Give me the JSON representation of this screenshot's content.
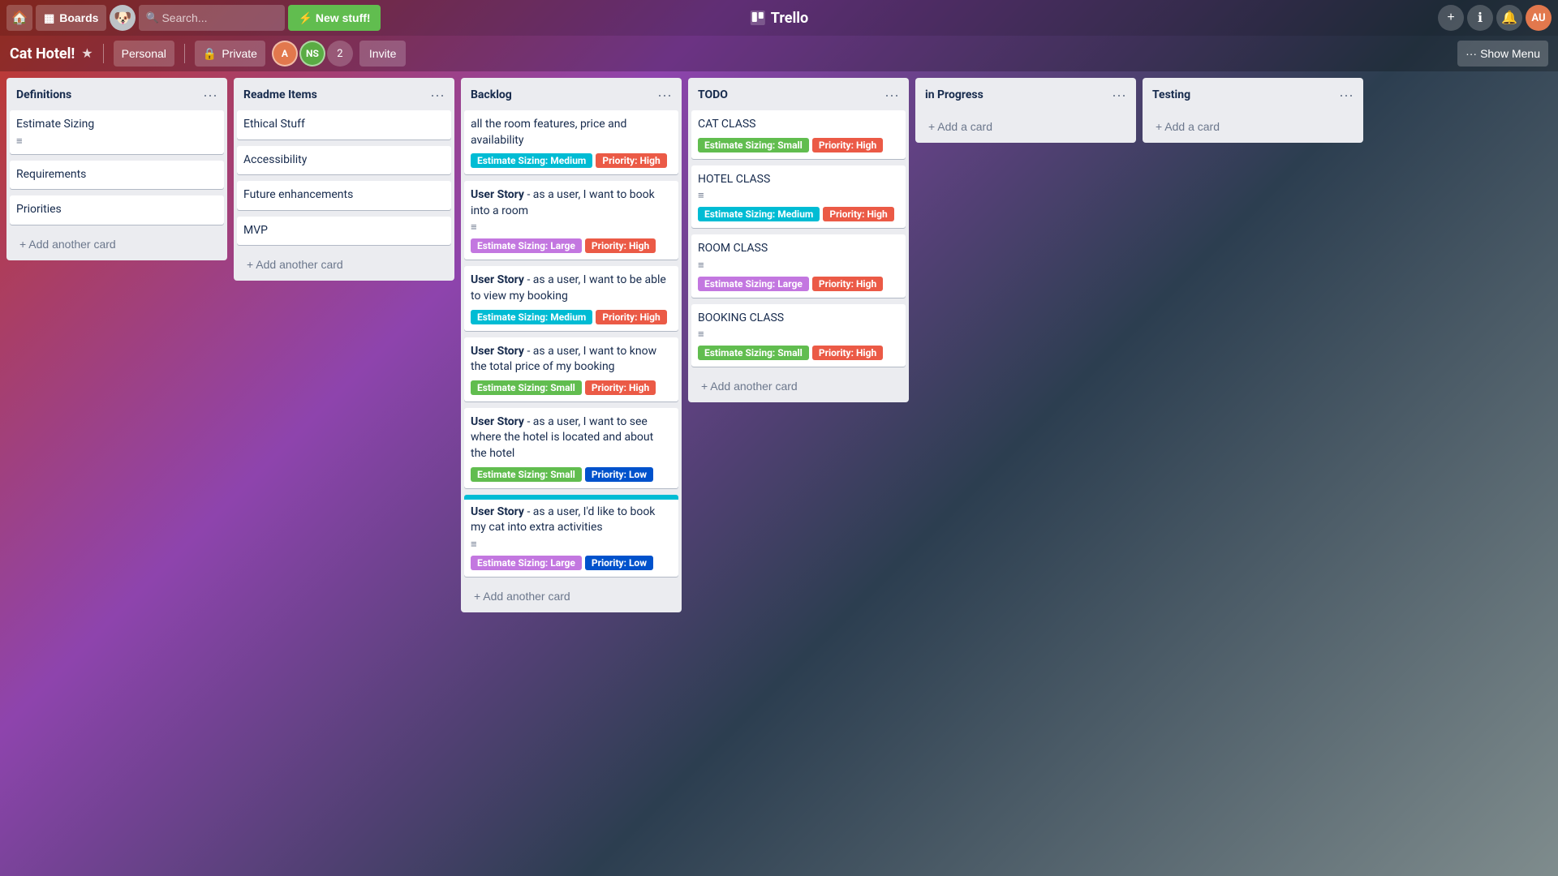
{
  "topNav": {
    "homeLabel": "🏠",
    "boardsLabel": "Boards",
    "searchPlaceholder": "Search...",
    "newStuffLabel": "New stuff!",
    "trelloLogo": "Trello",
    "addIcon": "+",
    "helpIcon": "?",
    "notifIcon": "🔔",
    "plusIcon": "+"
  },
  "boardNav": {
    "title": "Cat Hotel!",
    "starIcon": "★",
    "personalLabel": "Personal",
    "privateIcon": "🔒",
    "privateLabel": "Private",
    "memberCount": "2",
    "inviteLabel": "Invite",
    "showMenuDots": "···",
    "showMenuLabel": "Show Menu"
  },
  "lists": [
    {
      "id": "definitions",
      "title": "Definitions",
      "cards": [
        {
          "id": "d1",
          "title": "Estimate Sizing",
          "badges": [],
          "hasDesc": true,
          "stripe": null
        },
        {
          "id": "d2",
          "title": "Requirements",
          "badges": [],
          "hasDesc": false,
          "stripe": null
        },
        {
          "id": "d3",
          "title": "Priorities",
          "badges": [],
          "hasDesc": false,
          "stripe": null
        }
      ],
      "addLabel": "+ Add another card"
    },
    {
      "id": "readme",
      "title": "Readme Items",
      "cards": [
        {
          "id": "r1",
          "title": "Ethical Stuff",
          "badges": [],
          "hasDesc": false,
          "stripe": null
        },
        {
          "id": "r2",
          "title": "Accessibility",
          "badges": [],
          "hasDesc": false,
          "stripe": null
        },
        {
          "id": "r3",
          "title": "Future enhancements",
          "badges": [],
          "hasDesc": false,
          "stripe": null
        },
        {
          "id": "r4",
          "title": "MVP",
          "badges": [],
          "hasDesc": false,
          "stripe": null
        }
      ],
      "addLabel": "+ Add another card"
    },
    {
      "id": "backlog",
      "title": "Backlog",
      "cards": [
        {
          "id": "b1",
          "title": "all the room features, price and availability",
          "badges": [
            {
              "text": "Estimate Sizing: Medium",
              "color": "cyan"
            },
            {
              "text": "Priority: High",
              "color": "red"
            }
          ],
          "hasDesc": false,
          "stripe": null
        },
        {
          "id": "b2",
          "title": "User Story - as a user, I want to book into a room",
          "titleBold": "User Story",
          "badges": [
            {
              "text": "Estimate Sizing: Large",
              "color": "pink"
            },
            {
              "text": "Priority: High",
              "color": "red"
            }
          ],
          "hasDesc": true,
          "stripe": null
        },
        {
          "id": "b3",
          "title": "User Story - as a user, I want to be able to view my booking",
          "titleBold": "User Story",
          "badges": [
            {
              "text": "Estimate Sizing: Medium",
              "color": "cyan"
            },
            {
              "text": "Priority: High",
              "color": "red"
            }
          ],
          "hasDesc": false,
          "stripe": null
        },
        {
          "id": "b4",
          "title": "User Story - as a user, I want to know the total price of my booking",
          "titleBold": "User Story",
          "badges": [
            {
              "text": "Estimate Sizing: Small",
              "color": "teal"
            },
            {
              "text": "Priority: High",
              "color": "red"
            }
          ],
          "hasDesc": false,
          "stripe": null
        },
        {
          "id": "b5",
          "title": "User Story - as a user, I want to see where the hotel is located and about the hotel",
          "titleBold": "User Story",
          "badges": [
            {
              "text": "Estimate Sizing: Small",
              "color": "teal"
            },
            {
              "text": "Priority: Low",
              "color": "blue"
            }
          ],
          "hasDesc": false,
          "stripe": null
        },
        {
          "id": "b6",
          "title": "User Story - as a user, I'd like to book my cat into extra activities",
          "titleBold": "User Story",
          "badges": [
            {
              "text": "Estimate Sizing: Large",
              "color": "pink"
            },
            {
              "text": "Priority: Low",
              "color": "blue"
            }
          ],
          "hasDesc": true,
          "stripe": "cyan"
        }
      ],
      "addLabel": "+ Add another card"
    },
    {
      "id": "todo",
      "title": "TODO",
      "cards": [
        {
          "id": "t1",
          "title": "CAT CLASS",
          "badges": [
            {
              "text": "Estimate Sizing: Small",
              "color": "green"
            },
            {
              "text": "Priority: High",
              "color": "red"
            }
          ],
          "hasDesc": false,
          "stripe": null
        },
        {
          "id": "t2",
          "title": "HOTEL CLASS",
          "badges": [
            {
              "text": "Estimate Sizing: Medium",
              "color": "cyan"
            },
            {
              "text": "Priority: High",
              "color": "red"
            }
          ],
          "hasDesc": true,
          "stripe": null
        },
        {
          "id": "t3",
          "title": "ROOM CLASS",
          "badges": [
            {
              "text": "Estimate Sizing: Large",
              "color": "pink"
            },
            {
              "text": "Priority: High",
              "color": "red"
            }
          ],
          "hasDesc": true,
          "stripe": null
        },
        {
          "id": "t4",
          "title": "BOOKING CLASS",
          "badges": [
            {
              "text": "Estimate Sizing: Small",
              "color": "green"
            },
            {
              "text": "Priority: High",
              "color": "red"
            }
          ],
          "hasDesc": true,
          "stripe": null
        }
      ],
      "addLabel": "+ Add another card"
    },
    {
      "id": "inprogress",
      "title": "in Progress",
      "cards": [],
      "addLabel": "+ Add a card"
    },
    {
      "id": "testing",
      "title": "Testing",
      "cards": [],
      "addLabel": "+ Add a card"
    }
  ],
  "colors": {
    "cyan": "#00bcd4",
    "teal": "#61bd4f",
    "red": "#eb5a46",
    "pink": "#c377e0",
    "blue": "#0052cc",
    "green": "#61bd4f",
    "stripeColor": "#00bcd4"
  }
}
